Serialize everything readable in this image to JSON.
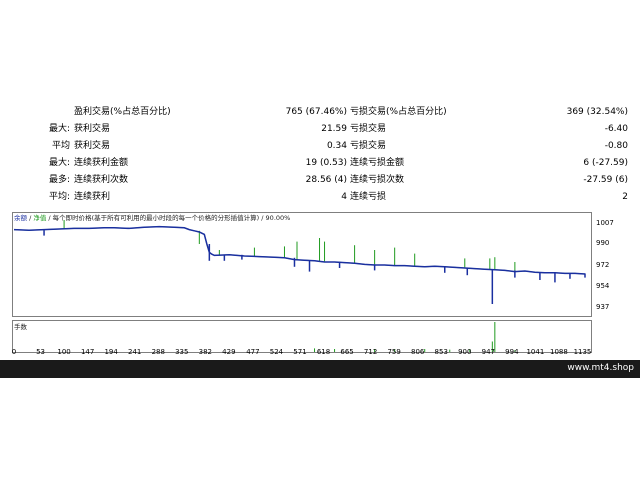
{
  "stats": [
    {
      "prefix": "",
      "label": "盈利交易(%占总百分比)",
      "value": "765 (67.46%)",
      "label2": "亏损交易(%占总百分比)",
      "value2": "369 (32.54%)"
    },
    {
      "prefix": "最大:",
      "label": "获利交易",
      "value": "21.59",
      "label2": "亏损交易",
      "value2": "-6.40"
    },
    {
      "prefix": "平均",
      "label": "获利交易",
      "value": "0.34",
      "label2": "亏损交易",
      "value2": "-0.80"
    },
    {
      "prefix": "最大:",
      "label": "连续获利金额",
      "value": "19 (0.53)",
      "label2": "连续亏损金额",
      "value2": "6 (-27.59)"
    },
    {
      "prefix": "最多:",
      "label": "连续获利次数",
      "value": "28.56 (4)",
      "label2": "连续亏损次数",
      "value2": "-27.59 (6)"
    },
    {
      "prefix": "平均:",
      "label": "连续获利",
      "value": "4",
      "label2": "连续亏损",
      "value2": "2"
    }
  ],
  "chart": {
    "title_balance": "余额",
    "title_sep": " / ",
    "title_equity": "净值",
    "title_rest": " / 每个即时价格(基于所有可利用的最小时段的每一个价格的分形插值计算) / 90.00%",
    "volume_label": "手数",
    "colors": {
      "balance": "#1a2fa0",
      "equity": "#1f9a1f"
    }
  },
  "chart_data": {
    "type": "line",
    "xlim": [
      0,
      1150
    ],
    "ylim": [
      930,
      1015
    ],
    "yticks": [
      1007,
      990,
      972,
      954,
      937
    ],
    "xticks": [
      0,
      53,
      100,
      147,
      194,
      241,
      288,
      335,
      382,
      429,
      477,
      524,
      571,
      618,
      665,
      712,
      759,
      806,
      853,
      900,
      947,
      994,
      1041,
      1088,
      1135
    ],
    "series": [
      {
        "name": "余额",
        "x": [
          0,
          30,
          60,
          90,
          120,
          150,
          180,
          200,
          230,
          260,
          290,
          320,
          340,
          350,
          360,
          370,
          380,
          385,
          390,
          395,
          400,
          430,
          460,
          490,
          520,
          540,
          560,
          580,
          600,
          610,
          620,
          640,
          660,
          680,
          700,
          720,
          740,
          760,
          780,
          800,
          820,
          840,
          860,
          880,
          900,
          920,
          940,
          960,
          980,
          1000,
          1020,
          1040,
          1060,
          1080,
          1100,
          1120,
          1140
        ],
        "y": [
          1002,
          1001.5,
          1002,
          1002.5,
          1003,
          1003,
          1003.5,
          1003.5,
          1003,
          1004,
          1004.5,
          1004,
          1003.5,
          1002,
          1001,
          1000,
          998,
          990,
          983,
          981.5,
          980.5,
          981,
          980,
          979.5,
          979,
          978.5,
          977,
          976.5,
          976,
          975.5,
          975,
          975,
          974.5,
          974,
          973,
          972.5,
          972.5,
          972,
          972,
          971.5,
          971,
          971.5,
          971,
          970.5,
          970,
          969.5,
          969,
          968.5,
          968,
          967,
          967.5,
          966.5,
          966,
          966,
          965.5,
          965.5,
          965
        ]
      },
      {
        "name": "净值",
        "x": [
          0,
          30,
          60,
          90,
          120,
          150,
          180,
          200,
          230,
          260,
          290,
          320,
          340,
          350,
          360,
          370,
          380,
          385,
          390,
          395,
          400,
          430,
          460,
          490,
          520,
          540,
          560,
          580,
          600,
          610,
          620,
          640,
          660,
          680,
          700,
          720,
          740,
          760,
          780,
          800,
          820,
          840,
          860,
          880,
          900,
          920,
          940,
          960,
          980,
          1000,
          1020,
          1040,
          1060,
          1080,
          1100,
          1120,
          1140
        ],
        "y": [
          1002,
          1001.5,
          1002,
          1002.5,
          1003,
          1003,
          1003.5,
          1003.5,
          1003,
          1004,
          1004.5,
          1004,
          1003.5,
          1002,
          1001,
          1000,
          998,
          990,
          983,
          981.5,
          980.5,
          981,
          980,
          979.5,
          979,
          978.5,
          977,
          976.5,
          976,
          975.5,
          975,
          975,
          974.5,
          974,
          973,
          972.5,
          972.5,
          972,
          972,
          971.5,
          971,
          971.5,
          971,
          970.5,
          970,
          969.5,
          969,
          968.5,
          968,
          967,
          967.5,
          966.5,
          966,
          966,
          965.5,
          965.5,
          965
        ]
      }
    ],
    "balance_dips": [
      [
        60,
        997
      ],
      [
        390,
        976
      ],
      [
        420,
        976
      ],
      [
        455,
        977
      ],
      [
        560,
        971
      ],
      [
        590,
        967
      ],
      [
        650,
        970
      ],
      [
        720,
        968
      ],
      [
        860,
        966
      ],
      [
        905,
        964
      ],
      [
        955,
        940
      ],
      [
        1000,
        962
      ],
      [
        1050,
        960
      ],
      [
        1080,
        958
      ],
      [
        1110,
        961
      ],
      [
        1140,
        962
      ]
    ],
    "equity_spikes": [
      [
        100,
        1010
      ],
      [
        370,
        990
      ],
      [
        410,
        985
      ],
      [
        480,
        987
      ],
      [
        540,
        988
      ],
      [
        565,
        992
      ],
      [
        610,
        995
      ],
      [
        620,
        992
      ],
      [
        680,
        989
      ],
      [
        720,
        985
      ],
      [
        760,
        987
      ],
      [
        800,
        982
      ],
      [
        900,
        978
      ],
      [
        950,
        978
      ],
      [
        960,
        979
      ],
      [
        1000,
        975
      ]
    ],
    "volume_spikes": [
      [
        960,
        1.0
      ],
      [
        955,
        0.35
      ],
      [
        600,
        0.12
      ],
      [
        640,
        0.1
      ],
      [
        720,
        0.1
      ],
      [
        760,
        0.08
      ],
      [
        820,
        0.1
      ],
      [
        870,
        0.08
      ],
      [
        910,
        0.1
      ],
      [
        1000,
        0.06
      ]
    ]
  },
  "footer": {
    "site": "www.mt4.shop"
  }
}
